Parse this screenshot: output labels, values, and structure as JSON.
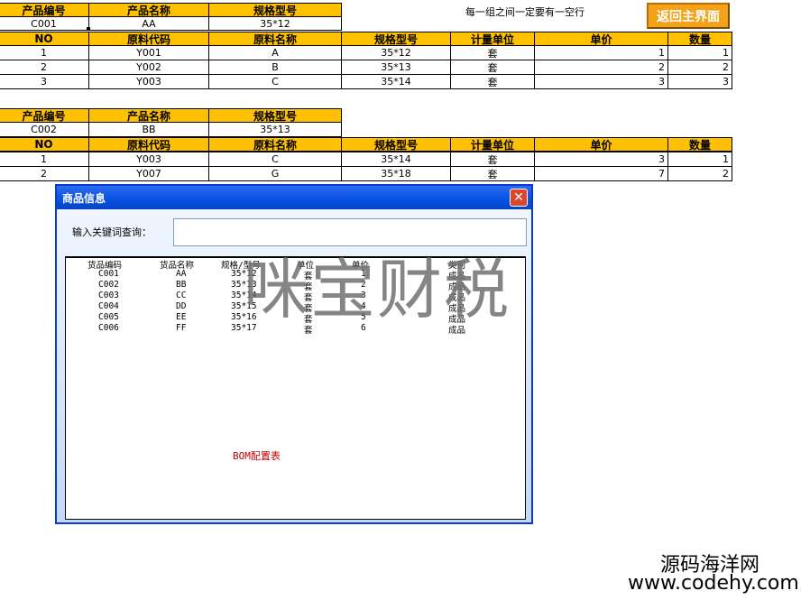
{
  "note": "每一组之间一定要有一空行",
  "return_button": "返回主界面",
  "groups": [
    {
      "header_labels": [
        "产品编号",
        "产品名称",
        "规格型号"
      ],
      "product": [
        "C001",
        "AA",
        "35*12"
      ],
      "material_labels": [
        "NO",
        "原料代码",
        "原料名称",
        "规格型号",
        "计量单位",
        "单价",
        "数量"
      ],
      "rows": [
        [
          "1",
          "Y001",
          "A",
          "35*12",
          "套",
          "1",
          "1"
        ],
        [
          "2",
          "Y002",
          "B",
          "35*13",
          "套",
          "2",
          "2"
        ],
        [
          "3",
          "Y003",
          "C",
          "35*14",
          "套",
          "3",
          "3"
        ]
      ]
    },
    {
      "header_labels": [
        "产品编号",
        "产品名称",
        "规格型号"
      ],
      "product": [
        "C002",
        "BB",
        "35*13"
      ],
      "material_labels": [
        "NO",
        "原料代码",
        "原料名称",
        "规格型号",
        "计量单位",
        "单价",
        "数量"
      ],
      "rows": [
        [
          "1",
          "Y003",
          "C",
          "35*14",
          "套",
          "3",
          "1"
        ],
        [
          "2",
          "Y007",
          "G",
          "35*18",
          "套",
          "7",
          "2"
        ]
      ]
    }
  ],
  "dialog": {
    "title": "商品信息",
    "close": "✕",
    "query_label": "输入关键词查询：",
    "query_value": "",
    "list_headers": [
      "货品编码",
      "货品名称",
      "规格/型号",
      "单位",
      "单价",
      "类别"
    ],
    "list_rows": [
      [
        "C001",
        "AA",
        "35*12",
        "套",
        "1",
        "成品"
      ],
      [
        "C002",
        "BB",
        "35*13",
        "套",
        "2",
        "成品"
      ],
      [
        "C003",
        "CC",
        "35*14",
        "套",
        "3",
        "成品"
      ],
      [
        "C004",
        "DD",
        "35*15",
        "套",
        "4",
        "成品"
      ],
      [
        "C005",
        "EE",
        "35*16",
        "套",
        "5",
        "成品"
      ],
      [
        "C006",
        "FF",
        "35*17",
        "套",
        "6",
        "成品"
      ]
    ],
    "bom_label": "BOM配置表"
  },
  "watermarks": {
    "main": "咪宝财税",
    "site_name": "源码海洋网",
    "site_url": "www.codehy.com"
  }
}
